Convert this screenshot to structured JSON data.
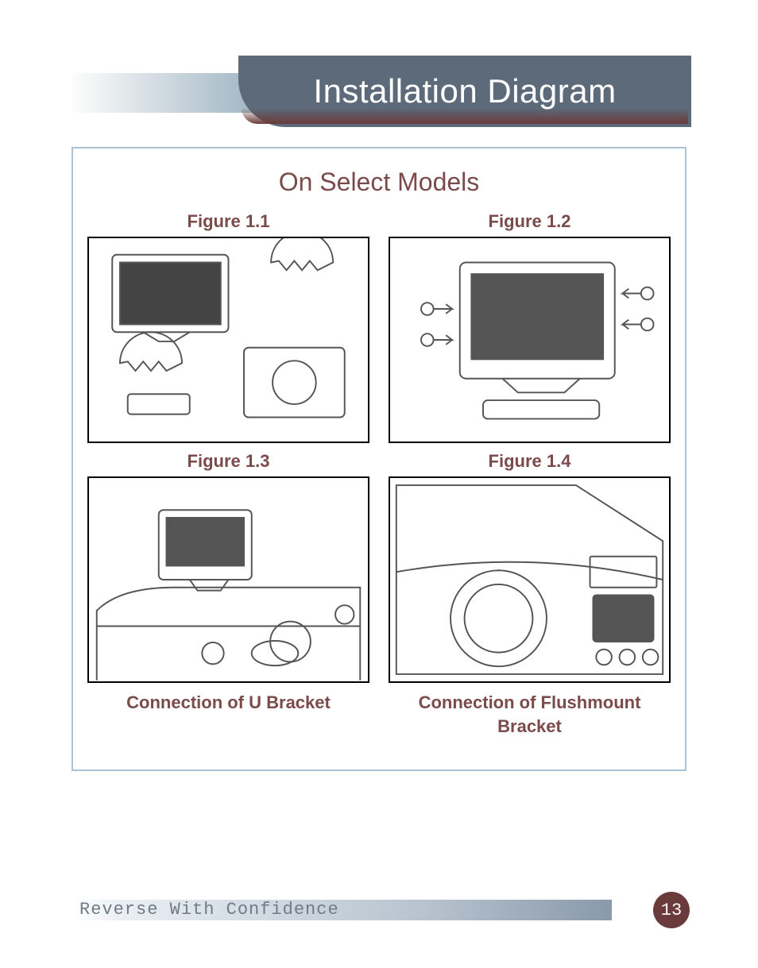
{
  "header": {
    "title": "Installation Diagram"
  },
  "section": {
    "subtitle": "On Select Models"
  },
  "figures": {
    "f11": {
      "label": "Figure 1.1"
    },
    "f12": {
      "label": "Figure 1.2"
    },
    "f13": {
      "label": "Figure 1.3"
    },
    "f14": {
      "label": "Figure 1.4"
    }
  },
  "captions": {
    "left": "Connection of U Bracket",
    "right": "Connection of Flushmount  Bracket"
  },
  "footer": {
    "tagline": "Reverse With Confidence",
    "page": "13"
  }
}
